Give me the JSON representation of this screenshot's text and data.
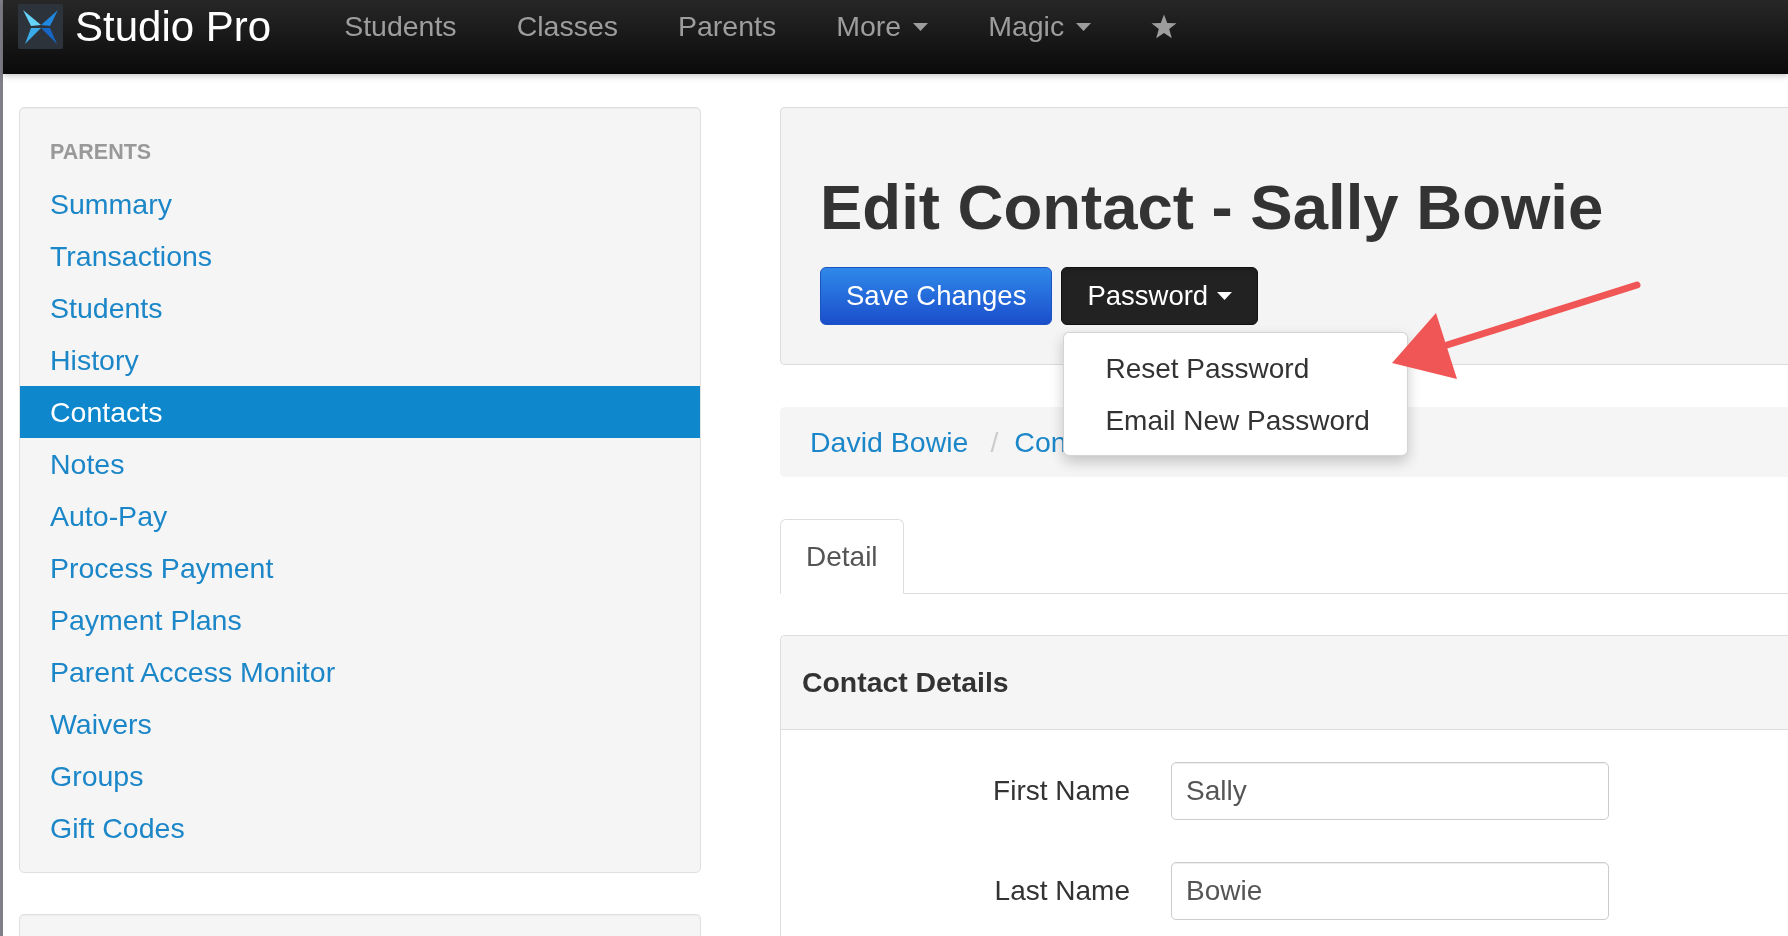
{
  "navbar": {
    "brand": "Studio Pro",
    "items": [
      {
        "label": "Students",
        "kind": "link"
      },
      {
        "label": "Classes",
        "kind": "link"
      },
      {
        "label": "Parents",
        "kind": "link"
      },
      {
        "label": "More",
        "kind": "dropdown"
      },
      {
        "label": "Magic",
        "kind": "dropdown"
      },
      {
        "kind": "star"
      }
    ]
  },
  "sidebar": {
    "heading": "PARENTS",
    "items": [
      {
        "label": "Summary",
        "selected": false
      },
      {
        "label": "Transactions",
        "selected": false
      },
      {
        "label": "Students",
        "selected": false
      },
      {
        "label": "History",
        "selected": false
      },
      {
        "label": "Contacts",
        "selected": true
      },
      {
        "label": "Notes",
        "selected": false
      },
      {
        "label": "Auto-Pay",
        "selected": false
      },
      {
        "label": "Process Payment",
        "selected": false
      },
      {
        "label": "Payment Plans",
        "selected": false
      },
      {
        "label": "Parent Access Monitor",
        "selected": false
      },
      {
        "label": "Waivers",
        "selected": false
      },
      {
        "label": "Groups",
        "selected": false
      },
      {
        "label": "Gift Codes",
        "selected": false
      }
    ]
  },
  "page_header": {
    "title": "Edit Contact - Sally Bowie",
    "buttons": [
      {
        "label": "Save Changes",
        "kind": "primary"
      },
      {
        "label": "Password",
        "kind": "dropdown",
        "expanded": true,
        "menu": [
          "Reset Password",
          "Email New Password"
        ]
      }
    ]
  },
  "breadcrumb": {
    "items": [
      "David Bowie",
      "Con"
    ],
    "separator": "/"
  },
  "tabs": [
    {
      "label": "Detail",
      "selected": true
    }
  ],
  "panel": {
    "title": "Contact Details",
    "fields": [
      {
        "label": "First Name",
        "value": "Sally"
      },
      {
        "label": "Last Name",
        "value": "Bowie"
      }
    ]
  },
  "callout_arrow": true
}
